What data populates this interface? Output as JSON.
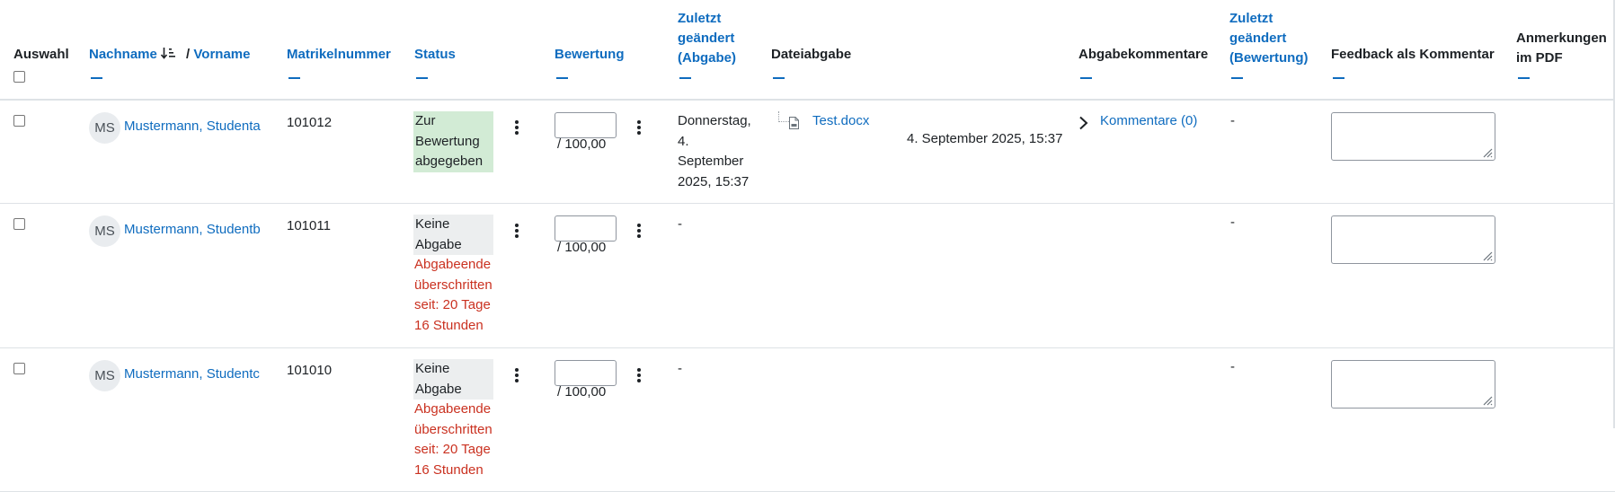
{
  "headers": {
    "select": "Auswahl",
    "lastname": "Nachname",
    "name_separator": "/",
    "firstname": "Vorname",
    "idnumber": "Matrikelnummer",
    "status": "Status",
    "grade": "Bewertung",
    "timesubmitted": "Zuletzt geändert (Abgabe)",
    "files": "Dateiabgabe",
    "comments": "Abgabekommentare",
    "timemarked": "Zuletzt geändert (Bewertung)",
    "feedback": "Feedback als Kommentar",
    "annotations": "Anmerkungen im PDF"
  },
  "rows": [
    {
      "initials": "MS",
      "name": "Mustermann, Studenta",
      "idnumber": "101012",
      "status": "Zur Bewertung abgegeben",
      "overdue": "",
      "grade_value": "",
      "grade_max": "/ 100,00",
      "time_submitted": "Donnerstag, 4. September 2025, 15:37",
      "file_name": "Test.docx",
      "file_date": "4. September 2025, 15:37",
      "comments_label": "Kommentare (0)",
      "time_graded": "-",
      "feedback": ""
    },
    {
      "initials": "MS",
      "name": "Mustermann, Studentb",
      "idnumber": "101011",
      "status": "Keine Abgabe",
      "overdue": "Abgabeende überschritten seit: 20 Tage 16 Stunden",
      "grade_value": "",
      "grade_max": "/ 100,00",
      "time_submitted": "-",
      "file_name": "",
      "file_date": "",
      "comments_label": "",
      "time_graded": "-",
      "feedback": ""
    },
    {
      "initials": "MS",
      "name": "Mustermann, Studentc",
      "idnumber": "101010",
      "status": "Keine Abgabe",
      "overdue": "Abgabeende überschritten seit: 20 Tage 16 Stunden",
      "grade_value": "",
      "grade_max": "/ 100,00",
      "time_submitted": "-",
      "file_name": "",
      "file_date": "",
      "comments_label": "",
      "time_graded": "-",
      "feedback": ""
    }
  ],
  "icons": {
    "sort": "sort-ascending-icon",
    "actions": "kebab-menu-icon",
    "file": "document-file-icon",
    "expand": "chevron-right-icon",
    "collapse": "collapse-column-icon",
    "resize": "resize-grip-icon"
  },
  "colors": {
    "link": "#0f6cbf",
    "submitted_bg": "#d2ebd5",
    "nosubmission_bg": "#eceeef",
    "overdue": "#ca3120",
    "text": "#1d2125",
    "border": "#dee2e6"
  }
}
